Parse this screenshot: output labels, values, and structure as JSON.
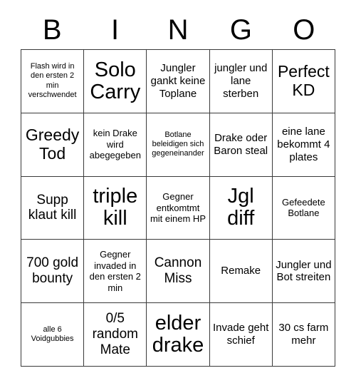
{
  "card": {
    "header_letters": [
      "B",
      "I",
      "N",
      "G",
      "O"
    ],
    "columns": 5,
    "rows": 5,
    "background_color": "#ffffff",
    "text_color": "#000000",
    "border_color": "#3a3a3a",
    "cells": [
      {
        "text": "Flash wird in den ersten 2 min verschwendet",
        "size": "xs"
      },
      {
        "text": "Solo Carry",
        "size": "xxl"
      },
      {
        "text": "Jungler gankt keine Toplane",
        "size": "md"
      },
      {
        "text": "jungler und lane sterben",
        "size": "md"
      },
      {
        "text": "Perfect KD",
        "size": "xl"
      },
      {
        "text": "Greedy Tod",
        "size": "xl"
      },
      {
        "text": "kein Drake wird abegegeben",
        "size": "sm"
      },
      {
        "text": "Botlane beleidigen sich gegeneinander",
        "size": "xs"
      },
      {
        "text": "Drake oder Baron steal",
        "size": "md"
      },
      {
        "text": "eine lane bekommt 4 plates",
        "size": "md"
      },
      {
        "text": "Supp klaut kill",
        "size": "lg"
      },
      {
        "text": "triple kill",
        "size": "xxl"
      },
      {
        "text": "Gegner entkomtmt mit einem HP",
        "size": "sm"
      },
      {
        "text": "Jgl diff",
        "size": "xxl"
      },
      {
        "text": "Gefeedete Botlane",
        "size": "sm"
      },
      {
        "text": "700 gold bounty",
        "size": "lg"
      },
      {
        "text": "Gegner invaded in den ersten 2 min",
        "size": "sm"
      },
      {
        "text": "Cannon Miss",
        "size": "lg"
      },
      {
        "text": "Remake",
        "size": "md"
      },
      {
        "text": "Jungler und Bot streiten",
        "size": "md"
      },
      {
        "text": "alle 6 Voidgubbies",
        "size": "xs"
      },
      {
        "text": "0/5 random Mate",
        "size": "lg"
      },
      {
        "text": "elder drake",
        "size": "xxl"
      },
      {
        "text": "Invade geht schief",
        "size": "md"
      },
      {
        "text": "30 cs farm mehr",
        "size": "md"
      }
    ]
  }
}
